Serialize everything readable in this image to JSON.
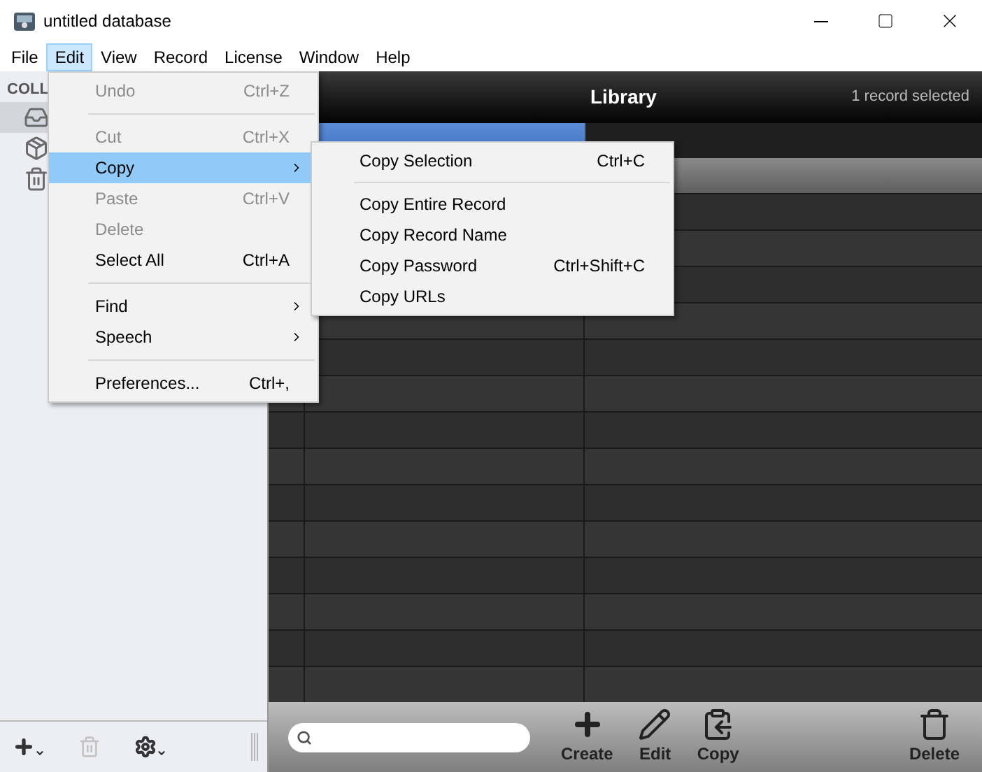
{
  "window": {
    "title": "untitled database"
  },
  "menubar": [
    {
      "label": "File",
      "selected": false
    },
    {
      "label": "Edit",
      "selected": true
    },
    {
      "label": "View",
      "selected": false
    },
    {
      "label": "Record",
      "selected": false
    },
    {
      "label": "License",
      "selected": false
    },
    {
      "label": "Window",
      "selected": false
    },
    {
      "label": "Help",
      "selected": false
    }
  ],
  "sidebar": {
    "heading": "COLL",
    "items": [
      {
        "kind": "inbox",
        "selected": true
      },
      {
        "kind": "box",
        "selected": false
      },
      {
        "kind": "trash",
        "selected": false
      }
    ],
    "toolbar": [
      {
        "kind": "add",
        "disabled": false
      },
      {
        "kind": "trash",
        "disabled": true
      },
      {
        "kind": "gear",
        "disabled": false
      }
    ]
  },
  "library": {
    "title": "Library",
    "status": "1 record selected",
    "rows": [
      {
        "selected": true
      },
      {
        "selected": false
      },
      {
        "selected": false
      },
      {
        "selected": false
      },
      {
        "selected": false
      },
      {
        "selected": false
      },
      {
        "selected": false
      },
      {
        "selected": false
      },
      {
        "selected": false
      },
      {
        "selected": false
      },
      {
        "selected": false
      },
      {
        "selected": false
      },
      {
        "selected": false
      },
      {
        "selected": false
      },
      {
        "selected": false
      }
    ]
  },
  "bottom_toolbar": {
    "buttons": [
      {
        "kind": "create",
        "label": "Create"
      },
      {
        "kind": "edit",
        "label": "Edit"
      },
      {
        "kind": "copy",
        "label": "Copy"
      },
      {
        "kind": "delete",
        "label": "Delete"
      }
    ]
  },
  "edit_menu": [
    {
      "kind": "item",
      "label": "Undo",
      "shortcut": "Ctrl+Z",
      "disabled": true,
      "selected": false
    },
    {
      "kind": "separator"
    },
    {
      "kind": "item",
      "label": "Cut",
      "shortcut": "Ctrl+X",
      "disabled": true,
      "selected": false
    },
    {
      "kind": "submenu",
      "label": "Copy",
      "disabled": false,
      "selected": true
    },
    {
      "kind": "item",
      "label": "Paste",
      "shortcut": "Ctrl+V",
      "disabled": true,
      "selected": false
    },
    {
      "kind": "item",
      "label": "Delete",
      "disabled": true,
      "selected": false
    },
    {
      "kind": "item",
      "label": "Select All",
      "shortcut": "Ctrl+A",
      "disabled": false,
      "selected": false
    },
    {
      "kind": "separator"
    },
    {
      "kind": "submenu",
      "label": "Find",
      "disabled": false,
      "selected": false
    },
    {
      "kind": "submenu",
      "label": "Speech",
      "disabled": false,
      "selected": false
    },
    {
      "kind": "separator"
    },
    {
      "kind": "item",
      "label": "Preferences...",
      "shortcut": "Ctrl+,",
      "disabled": false,
      "selected": false
    }
  ],
  "copy_submenu": [
    {
      "kind": "item",
      "label": "Copy Selection",
      "shortcut": "Ctrl+C"
    },
    {
      "kind": "separator"
    },
    {
      "kind": "item",
      "label": "Copy Entire Record"
    },
    {
      "kind": "item",
      "label": "Copy Record Name"
    },
    {
      "kind": "item",
      "label": "Copy Password",
      "shortcut": "Ctrl+Shift+C"
    },
    {
      "kind": "item",
      "label": "Copy URLs"
    }
  ]
}
